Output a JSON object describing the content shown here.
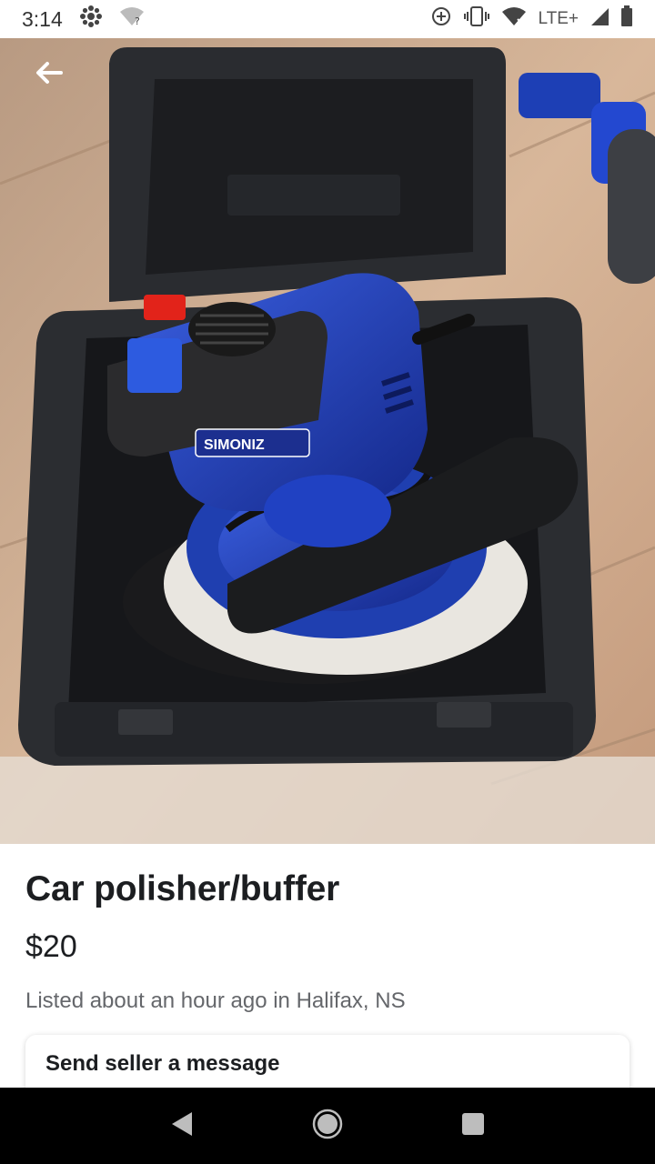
{
  "status_bar": {
    "time": "3:14",
    "network": "LTE+",
    "icons": [
      "cbc-gem-icon",
      "wifi-question-icon",
      "data-saver-icon",
      "vibrate-icon",
      "wifi-x-icon",
      "signal-icon",
      "battery-icon"
    ]
  },
  "listing": {
    "title": "Car polisher/buffer",
    "price": "$20",
    "listed": "Listed about an hour ago in Halifax, NS",
    "photo_brand_text": "SIMONIZ"
  },
  "message_card": {
    "title": "Send seller a message"
  },
  "nav": {
    "icons": [
      "back-triangle-icon",
      "home-circle-icon",
      "recents-square-icon"
    ]
  },
  "colors": {
    "case": "#2b2d31",
    "polisher_blue": "#1f3fb0",
    "floor": "#c9a58a",
    "pad": "#e9e6e0"
  }
}
